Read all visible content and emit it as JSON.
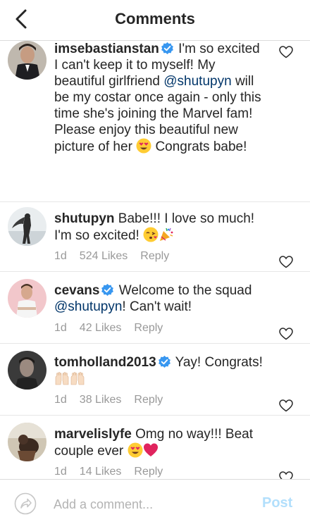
{
  "header": {
    "title": "Comments"
  },
  "comments": [
    {
      "username": "imsebastianstan",
      "verified": true,
      "text_1": " I'm so excited I can't keep it to myself! My beautiful girlfriend ",
      "mention": "@shutupyn",
      "text_2": " will be my costar once again - only this time she's joining the Marvel fam! Please enjoy this beautiful new picture of her ",
      "text_3": " Congrats babe!",
      "emojis": [
        "heart-eyes-emoji"
      ]
    },
    {
      "username": "shutupyn",
      "verified": false,
      "text_1": " Babe!!! I love so much! I'm so excited! ",
      "emojis": [
        "kiss-emoji",
        "party-popper-emoji"
      ],
      "time": "1d",
      "likes": "524 Likes",
      "reply": "Reply"
    },
    {
      "username": "cevans",
      "verified": true,
      "text_1": " Welcome to the squad ",
      "mention": "@shutupyn",
      "text_2": "! Can't wait!",
      "time": "1d",
      "likes": "42 Likes",
      "reply": "Reply"
    },
    {
      "username": "tomholland2013",
      "verified": true,
      "text_1": " Yay! Congrats! ",
      "emojis": [
        "raised-hands-emoji",
        "raised-hands-emoji"
      ],
      "time": "1d",
      "likes": "38 Likes",
      "reply": "Reply"
    },
    {
      "username": "marvelislyfe",
      "verified": false,
      "text_1": " Omg no way!!! Beat couple ever ",
      "emojis": [
        "heart-eyes-emoji",
        "red-heart-emoji"
      ],
      "time": "1d",
      "likes": "14 Likes",
      "reply": "Reply"
    }
  ],
  "footer": {
    "placeholder": "Add a comment...",
    "post_label": "Post"
  },
  "colors": {
    "mention": "#003569",
    "meta": "#999999",
    "post_disabled": "#b2dffc",
    "verified": "#3897f0"
  }
}
